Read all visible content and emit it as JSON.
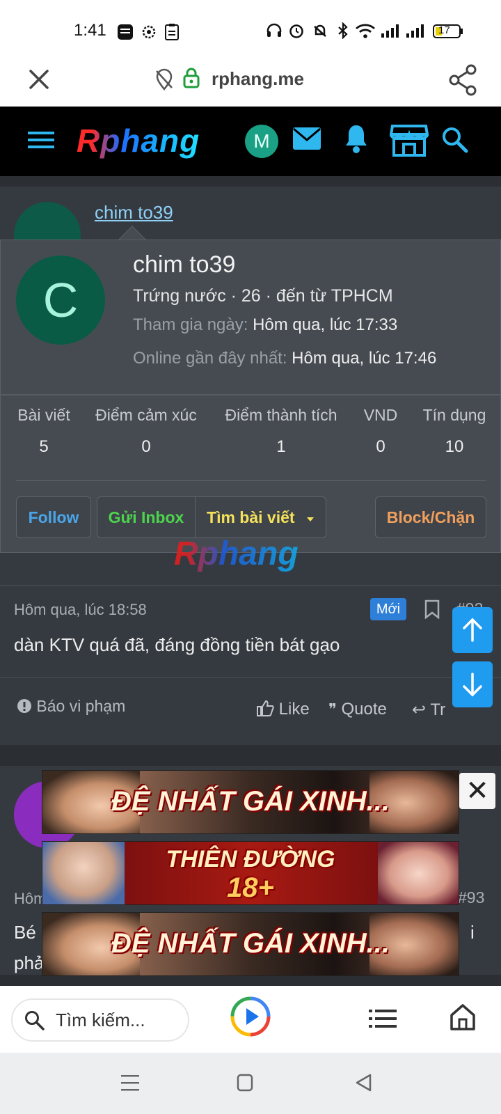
{
  "status_bar": {
    "time": "1:41",
    "battery": "17"
  },
  "url_bar": {
    "host": "rphang.me"
  },
  "site_header": {
    "logo": "Rphang",
    "user_initial": "M"
  },
  "post_header": {
    "username": "chim to39",
    "role": "Trứng nước"
  },
  "member_card": {
    "initial": "C",
    "name": "chim to39",
    "subtitle": "Trứng nước · 26 · đến từ TPHCM",
    "joined_label": "Tham gia ngày:",
    "joined_value": "Hôm qua, lúc 17:33",
    "online_label": "Online gần đây nhất:",
    "online_value": "Hôm qua, lúc 17:46",
    "stats": [
      {
        "label": "Bài viết",
        "value": "5"
      },
      {
        "label": "Điểm cảm xúc",
        "value": "0"
      },
      {
        "label": "Điểm thành tích",
        "value": "1"
      },
      {
        "label": "VND",
        "value": "0"
      },
      {
        "label": "Tín dụng",
        "value": "10"
      }
    ],
    "buttons": {
      "follow": "Follow",
      "inbox": "Gửi Inbox",
      "find_posts": "Tìm bài viết",
      "block": "Block/Chặn"
    }
  },
  "watermark": "Rphang",
  "post_92": {
    "time": "Hôm qua, lúc 18:58",
    "badge": "Mới",
    "number": "#92",
    "text": "dàn KTV quá đã, đáng đồng tiền bát gạo",
    "report": "Báo vi phạm",
    "like": "Like",
    "quote": "Quote",
    "reply": "Tr"
  },
  "post_93": {
    "time_fragment": "Hôm",
    "number": "#93",
    "text_fragment_1": "Bé",
    "text_fragment_2": "phả",
    "text_fragment_3": "i"
  },
  "ads": [
    {
      "text": "ĐỆ NHẤT GÁI XINH..."
    },
    {
      "text": "THIÊN ĐƯỜNG",
      "sub": "18+"
    },
    {
      "text": "ĐỆ NHẤT GÁI XINH..."
    }
  ],
  "bottom_bar": {
    "search_placeholder": "Tìm kiếm..."
  },
  "colors": {
    "accent_blue": "#1f9bf0",
    "follow": "#4aa6e8",
    "inbox": "#4cd44c",
    "find": "#f5e15a",
    "block": "#f0a05c"
  }
}
